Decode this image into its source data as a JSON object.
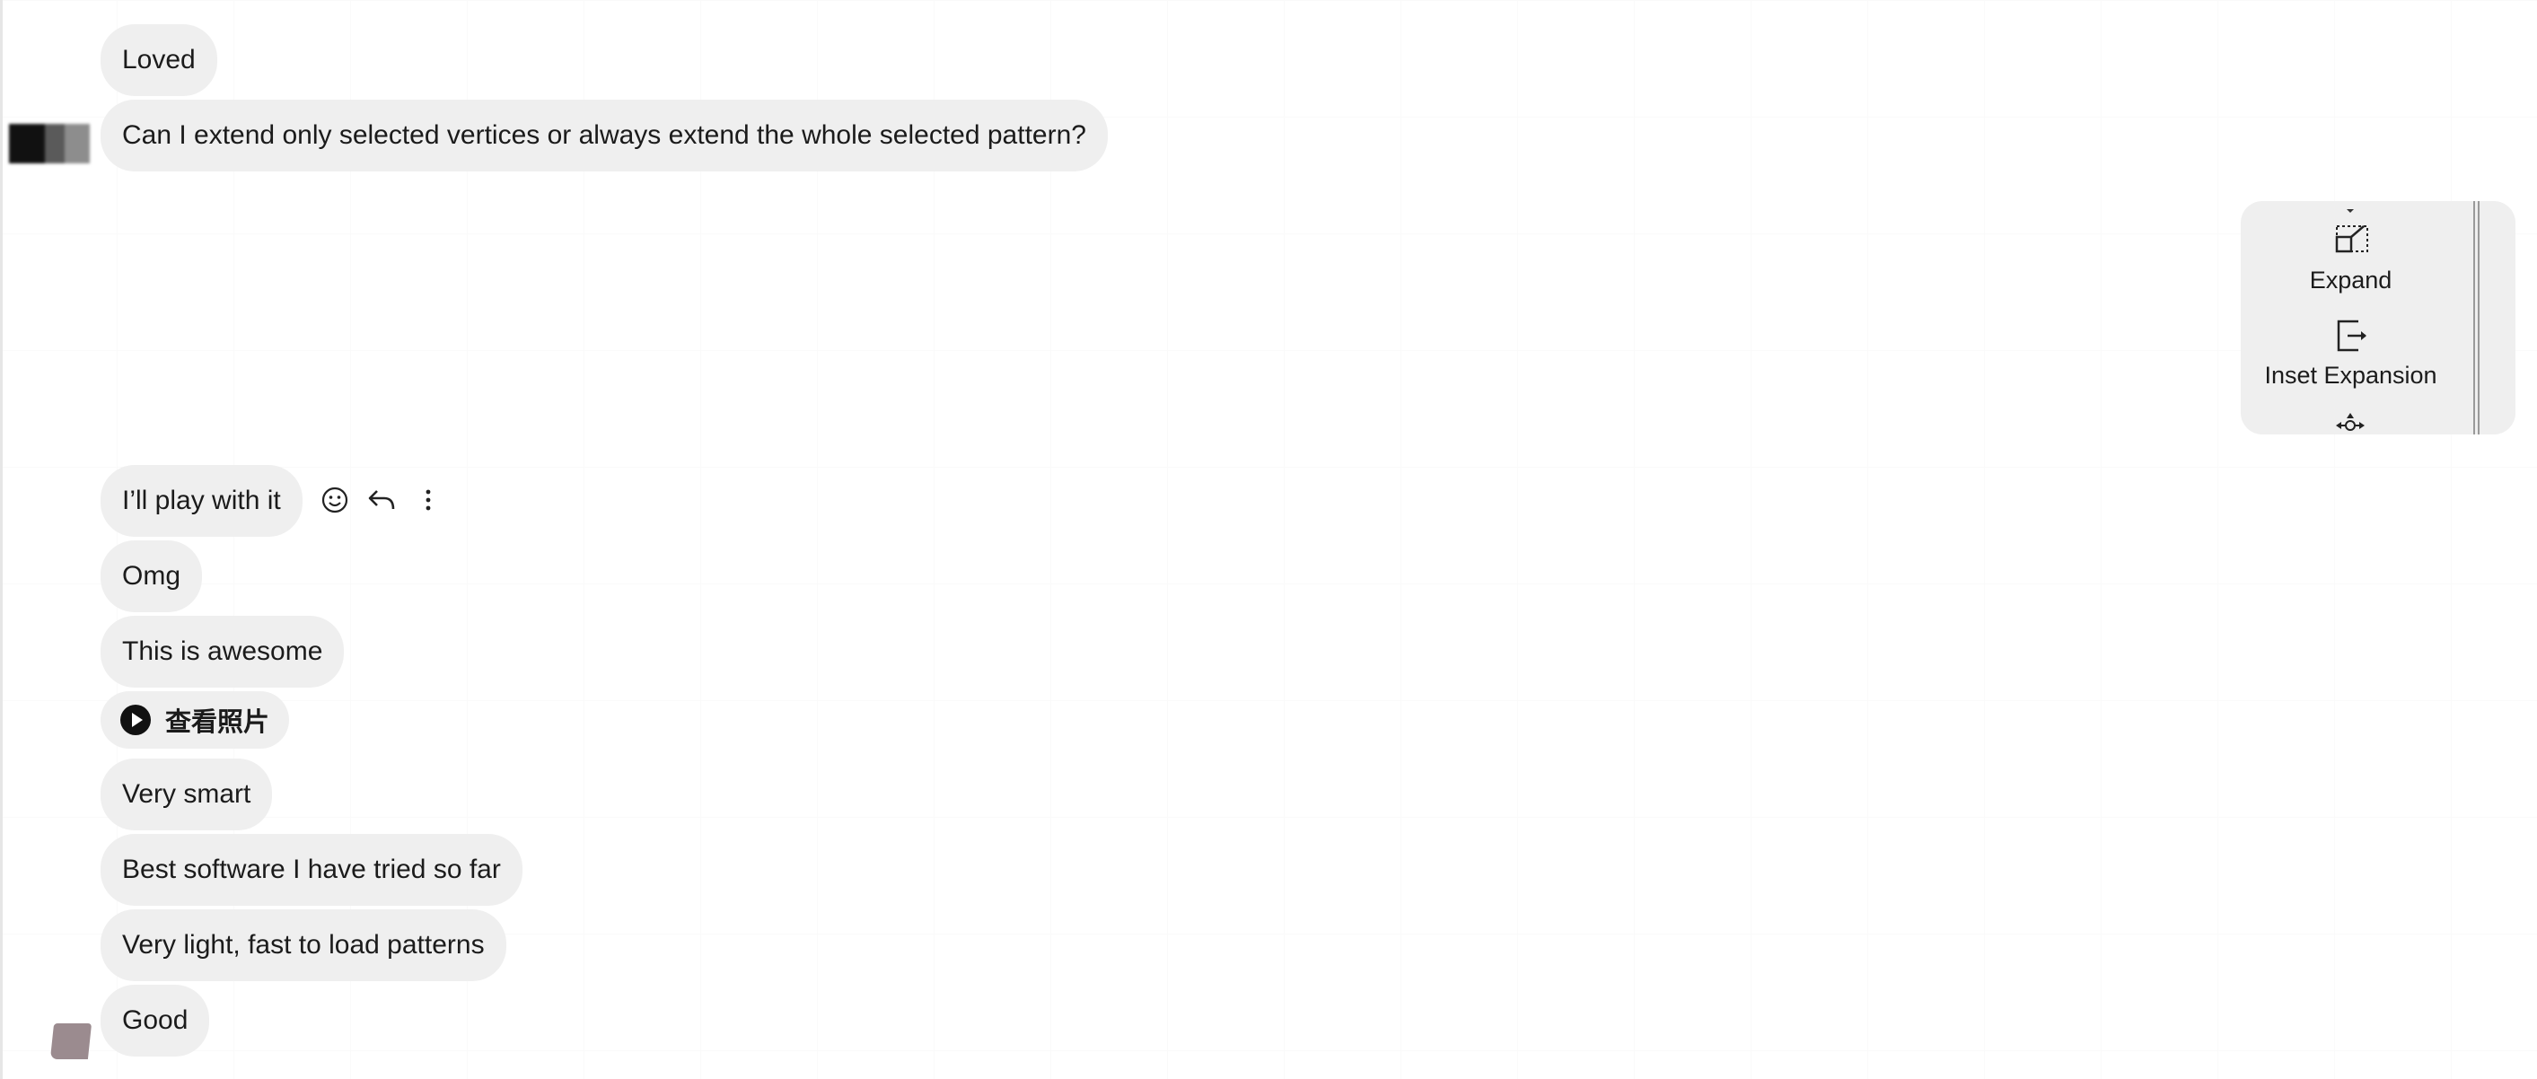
{
  "messages": [
    {
      "text": "Loved"
    },
    {
      "text": "Can I extend only selected vertices or always extend the whole selected pattern?"
    },
    {
      "text": "I’ll play with it"
    },
    {
      "text": "Omg"
    },
    {
      "text": "This is awesome"
    },
    {
      "text": "查看照片",
      "icon": "play-circle-icon"
    },
    {
      "text": "Very smart"
    },
    {
      "text": "Best software I have tried so far"
    },
    {
      "text": "Very light, fast to load patterns"
    },
    {
      "text": "Good"
    }
  ],
  "message_actions": {
    "icons": [
      "smiley-icon",
      "reply-arrow-icon",
      "more-vertical-icon"
    ]
  },
  "tool_panel": {
    "items": [
      {
        "label": "Expand",
        "icon": "expand-icon"
      },
      {
        "label": "Inset Expansion",
        "icon": "inset-expansion-icon"
      }
    ],
    "partial_icons": [
      "move-arrows-icon"
    ]
  },
  "colors": {
    "bubble": "#efefef",
    "text": "#1b1b1b",
    "panel": "#efefef"
  }
}
